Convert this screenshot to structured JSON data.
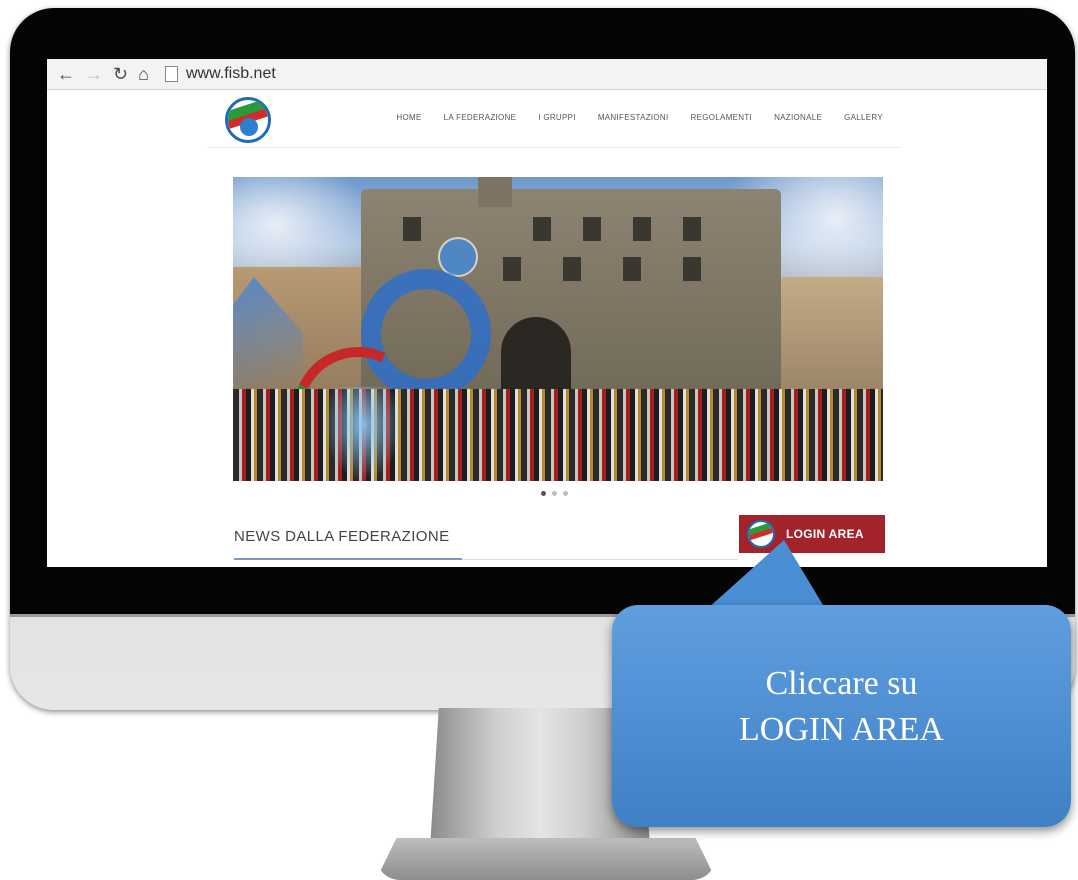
{
  "browser": {
    "back_icon": "arrow-left-icon",
    "forward_icon": "arrow-right-icon",
    "reload_icon": "reload-icon",
    "home_icon": "home-icon",
    "url": "www.fisb.net"
  },
  "site": {
    "nav": [
      "HOME",
      "LA FEDERAZIONE",
      "I GRUPPI",
      "MANIFESTAZIONI",
      "REGOLAMENTI",
      "NAZIONALE",
      "GALLERY"
    ],
    "carousel_dots": 3,
    "carousel_active_index": 0,
    "news_title": "NEWS DALLA FEDERAZIONE",
    "login_label": "LOGIN AREA",
    "login_color": "#a3232a"
  },
  "callout": {
    "line1": "Cliccare su",
    "line2": "LOGIN AREA",
    "color": "#4a8fd4"
  }
}
